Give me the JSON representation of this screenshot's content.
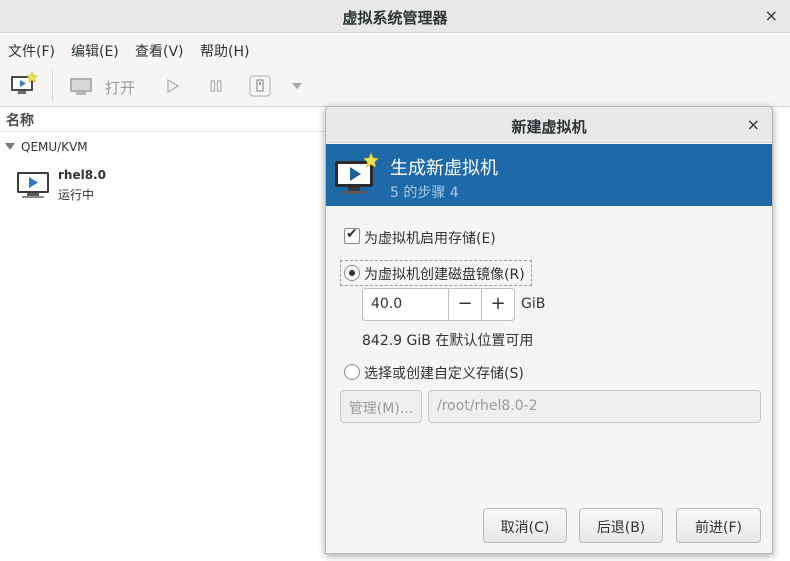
{
  "window": {
    "title": "虚拟系统管理器",
    "close": "×"
  },
  "menu": {
    "file": "文件(F)",
    "edit": "编辑(E)",
    "view": "查看(V)",
    "help": "帮助(H)"
  },
  "toolbar": {
    "open_label": "打开"
  },
  "list": {
    "header": "名称",
    "connection": "QEMU/KVM",
    "vm": {
      "name": "rhel8.0",
      "state": "运行中"
    }
  },
  "dialog": {
    "title": "新建虚拟机",
    "close": "×",
    "banner_title": "生成新虚拟机",
    "banner_step": "5 的步骤 4",
    "enable_storage": "为虚拟机启用存储(E)",
    "create_disk": "为虚拟机创建磁盘镜像(R)",
    "size_value": "40.0",
    "minus": "−",
    "plus": "+",
    "unit": "GiB",
    "available": "842.9 GiB 在默认位置可用",
    "custom_storage": "选择或创建自定义存储(S)",
    "manage_button": "管理(M)...",
    "path_value": "/root/rhel8.0-2",
    "cancel": "取消(C)",
    "back": "后退(B)",
    "forward": "前进(F)"
  },
  "colors": {
    "banner": "#1e6aa8",
    "window_bg": "#f6f5f4"
  }
}
